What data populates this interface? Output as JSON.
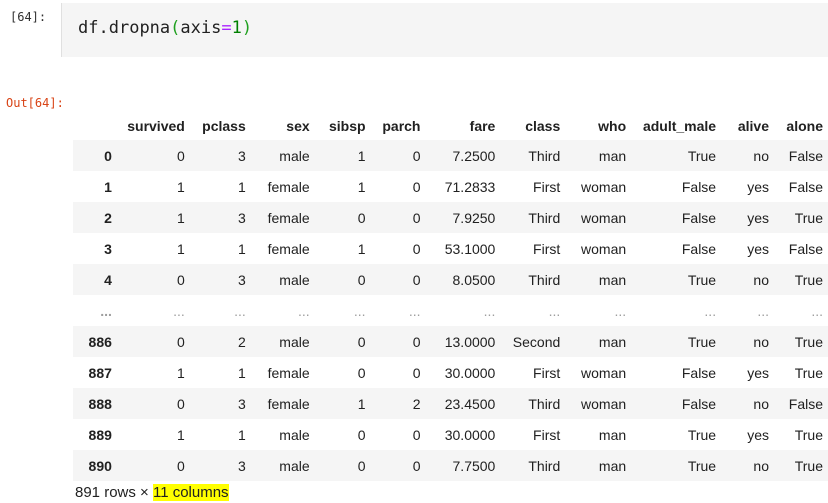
{
  "input_cell": {
    "prompt": "[64]:",
    "code": {
      "obj": "df",
      "dot": ".",
      "method": "dropna",
      "open": "(",
      "arg": "axis",
      "eq": "=",
      "val": "1",
      "close": ")"
    }
  },
  "output": {
    "prompt": "Out[64]:",
    "columns": [
      "",
      "survived",
      "pclass",
      "sex",
      "sibsp",
      "parch",
      "fare",
      "class",
      "who",
      "adult_male",
      "alive",
      "alone"
    ],
    "rows": [
      [
        "0",
        "0",
        "3",
        "male",
        "1",
        "0",
        "7.2500",
        "Third",
        "man",
        "True",
        "no",
        "False"
      ],
      [
        "1",
        "1",
        "1",
        "female",
        "1",
        "0",
        "71.2833",
        "First",
        "woman",
        "False",
        "yes",
        "False"
      ],
      [
        "2",
        "1",
        "3",
        "female",
        "0",
        "0",
        "7.9250",
        "Third",
        "woman",
        "False",
        "yes",
        "True"
      ],
      [
        "3",
        "1",
        "1",
        "female",
        "1",
        "0",
        "53.1000",
        "First",
        "woman",
        "False",
        "yes",
        "False"
      ],
      [
        "4",
        "0",
        "3",
        "male",
        "0",
        "0",
        "8.0500",
        "Third",
        "man",
        "True",
        "no",
        "True"
      ],
      [
        "...",
        "...",
        "...",
        "...",
        "...",
        "...",
        "...",
        "...",
        "...",
        "...",
        "...",
        "..."
      ],
      [
        "886",
        "0",
        "2",
        "male",
        "0",
        "0",
        "13.0000",
        "Second",
        "man",
        "True",
        "no",
        "True"
      ],
      [
        "887",
        "1",
        "1",
        "female",
        "0",
        "0",
        "30.0000",
        "First",
        "woman",
        "False",
        "yes",
        "True"
      ],
      [
        "888",
        "0",
        "3",
        "female",
        "1",
        "2",
        "23.4500",
        "Third",
        "woman",
        "False",
        "no",
        "False"
      ],
      [
        "889",
        "1",
        "1",
        "male",
        "0",
        "0",
        "30.0000",
        "First",
        "man",
        "True",
        "yes",
        "True"
      ],
      [
        "890",
        "0",
        "3",
        "male",
        "0",
        "0",
        "7.7500",
        "Third",
        "man",
        "True",
        "no",
        "True"
      ]
    ],
    "shape": {
      "rows_text": "891 rows ×",
      "columns_text": "11 columns"
    }
  },
  "colors": {
    "code_bg": "#f5f5f5",
    "out_prompt": "#d84315",
    "stripe": "#f5f5f5",
    "highlight": "#ffff00"
  }
}
